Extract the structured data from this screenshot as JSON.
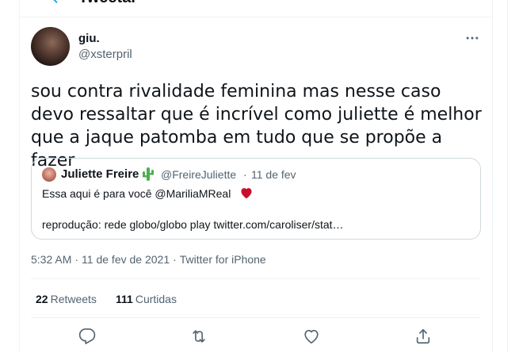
{
  "header": {
    "title": "Tweetar",
    "back_icon": "arrow-left-icon"
  },
  "tweet": {
    "display_name": "giu.",
    "username": "@xsterpril",
    "text": "sou contra rivalidade feminina mas nesse caso devo ressaltar que é incrível como juliette é melhor que a jaque patomba em tudo que se propõe a fazer",
    "more_icon": "more-horizontal-icon"
  },
  "quote": {
    "display_name": "Juliette Freire",
    "name_emoji": "cactus",
    "handle": "@FreireJuliette",
    "separator": "·",
    "date": "11 de fev",
    "line1": "Essa aqui é para você @MariliaMReal",
    "line1_emoji": "red-heart",
    "line2": "reprodução: rede globo/globo play twitter.com/caroliser/stat…"
  },
  "meta": {
    "time": "5:32 AM",
    "sep1": "·",
    "date": "11 de fev de 2021",
    "sep2": "·",
    "source": "Twitter for iPhone"
  },
  "stats": {
    "retweets_count": "22",
    "retweets_label": "Retweets",
    "likes_count": "111",
    "likes_label": "Curtidas"
  },
  "actions": [
    "reply-icon",
    "retweet-icon",
    "like-icon",
    "share-icon"
  ],
  "colors": {
    "text": "#0f1419",
    "secondary": "#536471",
    "border": "#cfd9de",
    "divider": "#eff3f4",
    "accent": "#1d9bf0",
    "heart": "#c8102e",
    "cactus": "#4caf50"
  }
}
